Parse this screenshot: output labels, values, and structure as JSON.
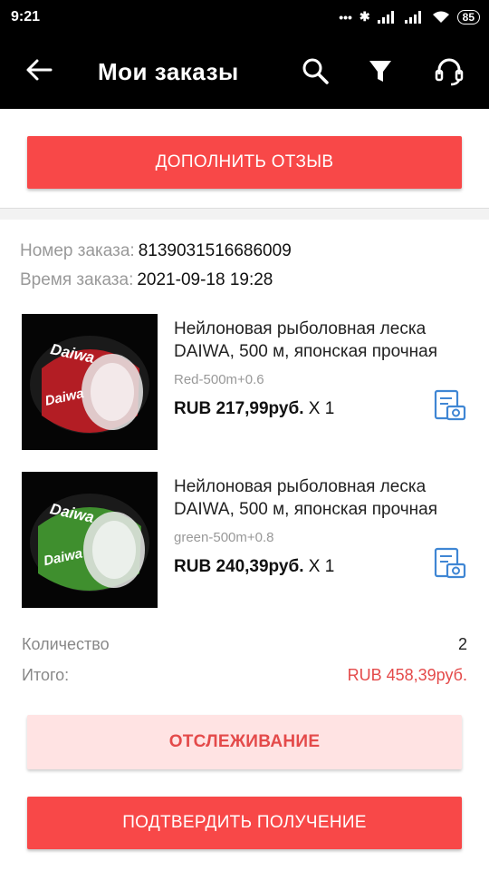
{
  "status_bar": {
    "time": "9:21",
    "battery": "85"
  },
  "app_bar": {
    "title": "Мои заказы"
  },
  "top_card": {
    "supplement_review_label": "ДОПОЛНИТЬ ОТЗЫВ"
  },
  "order": {
    "number_label": "Номер заказа:",
    "number": "8139031516686009",
    "time_label": "Время заказа:",
    "time": "2021-09-18 19:28",
    "items": [
      {
        "name_line1": "Нейлоновая рыболовная леска",
        "name_line2": "DAIWA, 500 м, японская прочная",
        "variant": "Red-500m+0.6",
        "price": "RUB 217,99руб.",
        "qty": "X 1",
        "thumb_color": "#b31d24",
        "thumb_brand": "Daiwa"
      },
      {
        "name_line1": "Нейлоновая рыболовная леска",
        "name_line2": "DAIWA, 500 м, японская прочная",
        "variant": "green-500m+0.8",
        "price": "RUB 240,39руб.",
        "qty": "X 1",
        "thumb_color": "#3f8f2e",
        "thumb_brand": "Daiwa"
      }
    ],
    "quantity_label": "Количество",
    "quantity": "2",
    "total_label": "Итого:",
    "total": "RUB 458,39руб."
  },
  "actions": {
    "tracking_label": "ОТСЛЕЖИВАНИЕ",
    "confirm_label": "ПОДТВЕРДИТЬ ПОЛУЧЕНИЕ"
  },
  "colors": {
    "accent_red": "#f84848",
    "total_red": "#e44a4a",
    "icon_blue": "#3f86d4"
  }
}
